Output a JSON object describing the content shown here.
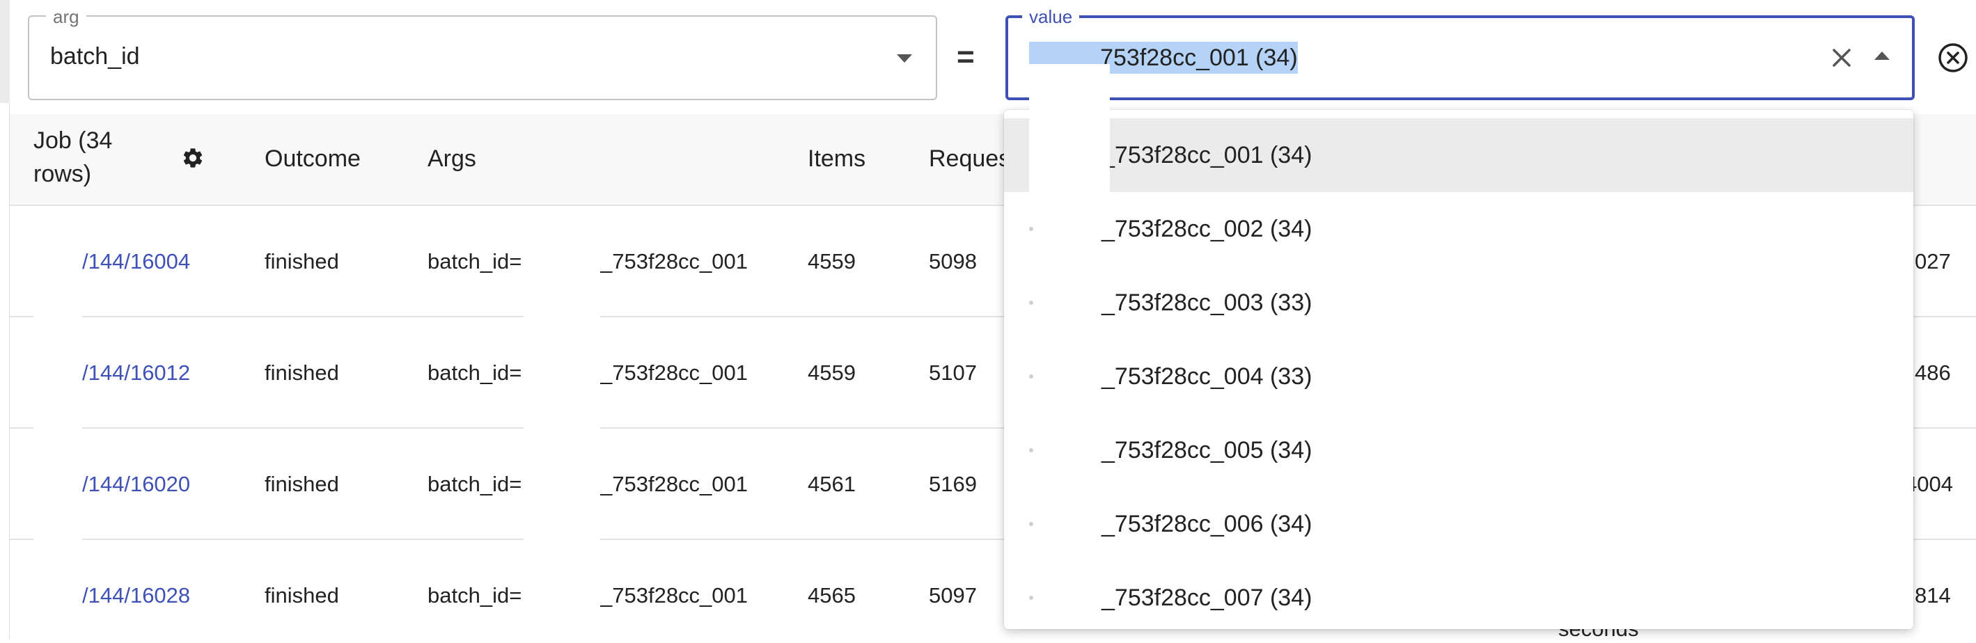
{
  "filter": {
    "arg": {
      "label": "arg",
      "value": "batch_id"
    },
    "operator": "=",
    "value": {
      "label": "value",
      "text": "_753f28cc_001 (34)"
    }
  },
  "table": {
    "headers": {
      "job": "Job (34 rows)",
      "outcome": "Outcome",
      "args": "Args",
      "items": "Items",
      "requests": "Reques"
    },
    "rows": [
      {
        "job": "/144/16004",
        "outcome": "finished",
        "args_prefix": "batch_id=",
        "args_suffix": "_753f28cc_001",
        "items": "4559",
        "requests": "5098",
        "right": "027"
      },
      {
        "job": "/144/16012",
        "outcome": "finished",
        "args_prefix": "batch_id=",
        "args_suffix": "_753f28cc_001",
        "items": "4559",
        "requests": "5107",
        "right": "486"
      },
      {
        "job": "/144/16020",
        "outcome": "finished",
        "args_prefix": "batch_id=",
        "args_suffix": "_753f28cc_001",
        "items": "4561",
        "requests": "5169",
        "right": "4004"
      },
      {
        "job": "/144/16028",
        "outcome": "finished",
        "args_prefix": "batch_id=",
        "args_suffix": "_753f28cc_001",
        "items": "4565",
        "requests": "5097",
        "right": "814"
      }
    ],
    "partial_text": "seconds"
  },
  "dropdown": {
    "options": [
      "_753f28cc_001 (34)",
      "_753f28cc_002 (34)",
      "_753f28cc_003 (33)",
      "_753f28cc_004 (33)",
      "_753f28cc_005 (34)",
      "_753f28cc_006 (34)",
      "_753f28cc_007 (34)"
    ]
  },
  "icons": {
    "arg_dropdown": "chevron-down-icon",
    "clear": "close-icon",
    "value_dropdown": "chevron-up-icon",
    "remove": "circle-close-icon",
    "settings": "gear-icon"
  },
  "colors": {
    "accent": "#3f51b5",
    "highlight": "#b4d3f7"
  }
}
